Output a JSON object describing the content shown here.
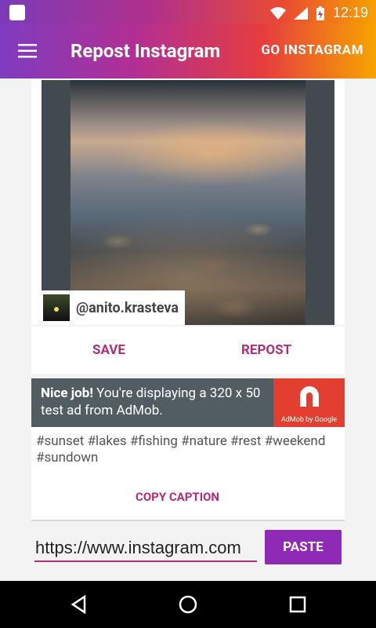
{
  "status": {
    "time": "12:19"
  },
  "appbar": {
    "title": "Repost Instagram",
    "action": "GO INSTAGRAM",
    "icon": "menu-icon"
  },
  "post": {
    "username": "@anito.krasteva"
  },
  "actions": {
    "save": "SAVE",
    "repost": "REPOST"
  },
  "ad": {
    "strong": "Nice job!",
    "text": " You're displaying a 320 x 50 test ad from AdMob.",
    "brand": "AdMob by Google"
  },
  "caption": {
    "text": "#sunset #lakes #fishing #nature #rest #weekend #sundown",
    "copy_label": "COPY CAPTION"
  },
  "url_input": {
    "value": "https://www.instagram.com",
    "paste_label": "PASTE"
  },
  "colors": {
    "accent": "#b02d78",
    "paste_bg": "#8e2ab6",
    "ad_bg": "#525d63",
    "ad_logo_bg": "#e23f31"
  }
}
